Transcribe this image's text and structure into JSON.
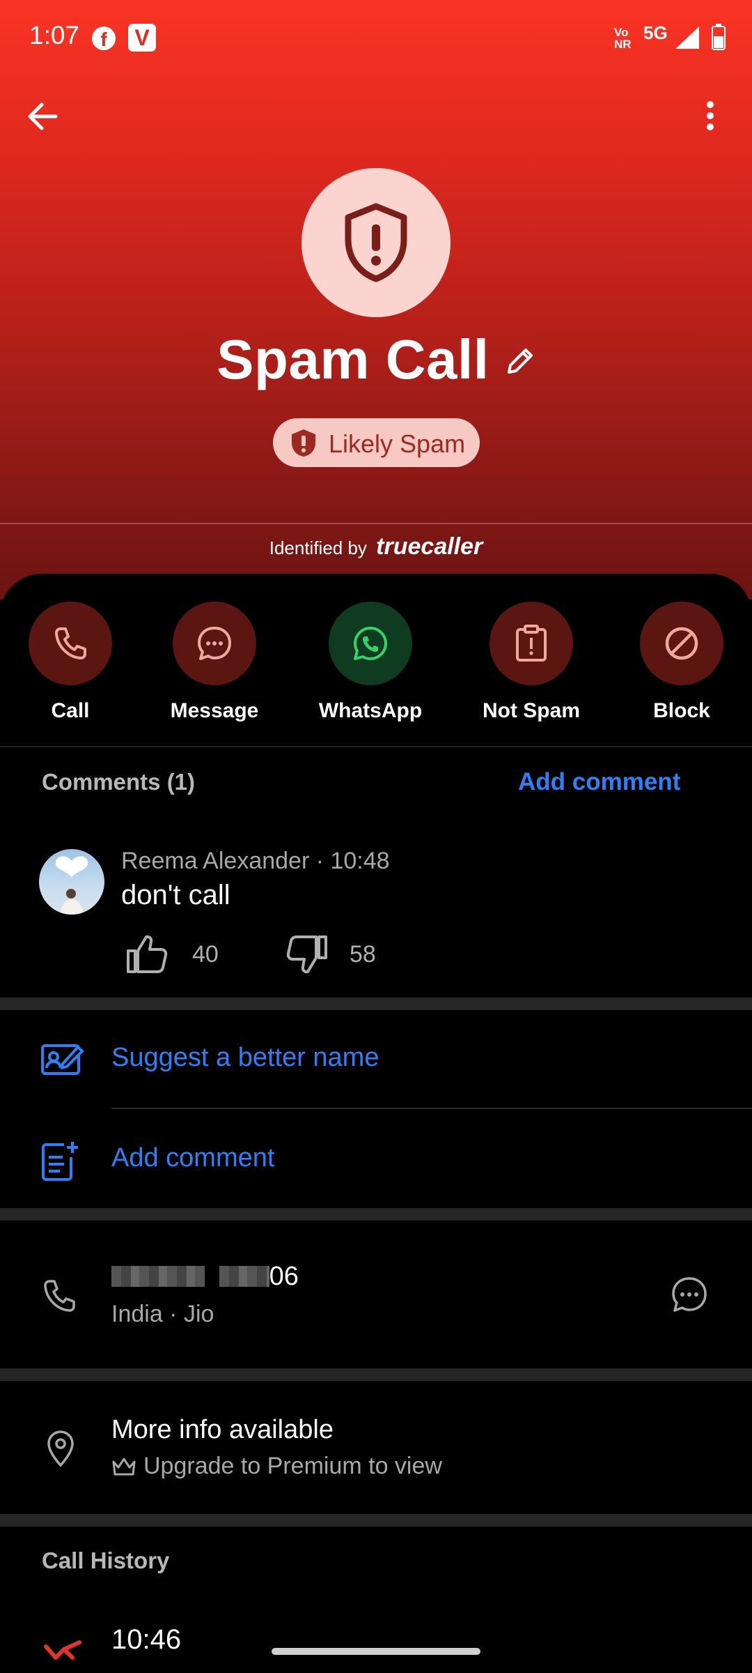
{
  "status_bar": {
    "time": "1:07",
    "volte_line1": "Vo",
    "volte_line2": "NR",
    "network": "5G"
  },
  "header": {
    "title": "Spam Call",
    "badge": "Likely Spam",
    "identified_prefix": "Identified by",
    "identified_brand": "truecaller"
  },
  "actions": [
    {
      "label": "Call",
      "icon": "phone-icon"
    },
    {
      "label": "Message",
      "icon": "chat-bubble-icon"
    },
    {
      "label": "WhatsApp",
      "icon": "whatsapp-icon"
    },
    {
      "label": "Not Spam",
      "icon": "report-icon"
    },
    {
      "label": "Block",
      "icon": "block-icon"
    }
  ],
  "comments": {
    "header": "Comments (1)",
    "add_label": "Add comment",
    "items": [
      {
        "author": "Reema Alexander",
        "time": "10:48",
        "meta": "Reema Alexander · 10:48",
        "text": "don't call",
        "likes": "40",
        "dislikes": "58"
      }
    ]
  },
  "links": {
    "suggest_name": "Suggest a better name",
    "add_comment": "Add comment"
  },
  "phone": {
    "number_suffix": "06",
    "carrier": "India · Jio"
  },
  "more_info": {
    "title": "More info available",
    "subtitle": "Upgrade to Premium to view"
  },
  "call_history": {
    "header": "Call History",
    "items": [
      {
        "time": "10:46",
        "type": "missed"
      }
    ]
  },
  "colors": {
    "accent_blue": "#2f80f5",
    "hero_top": "#fa3424",
    "hero_bottom": "#6a1412",
    "badge_bg": "#f7c9c3"
  }
}
